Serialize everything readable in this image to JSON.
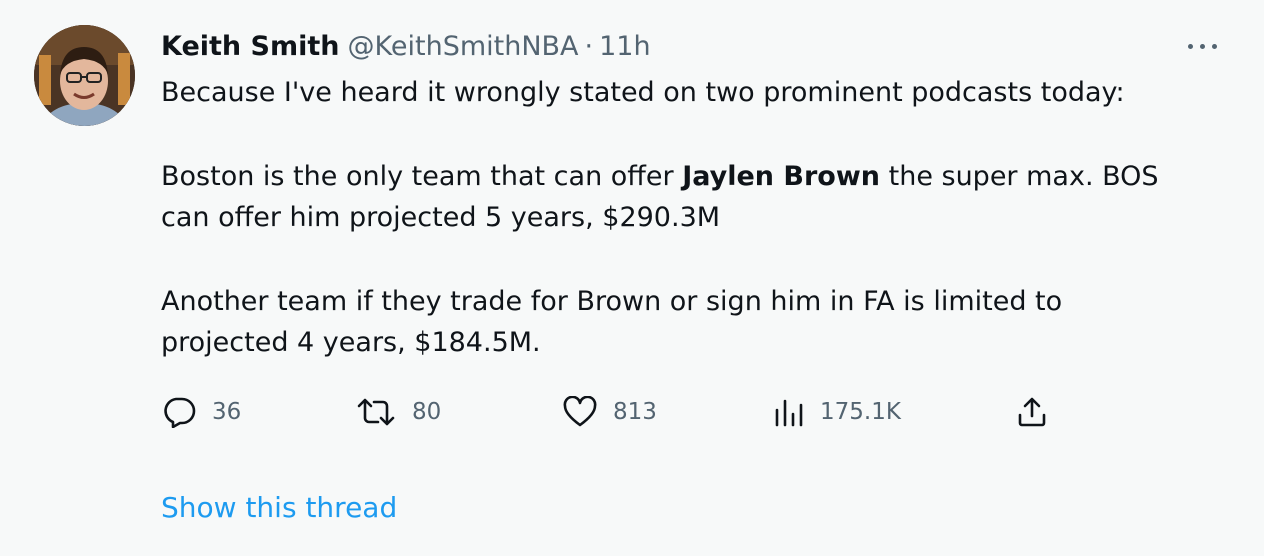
{
  "tweet": {
    "author_name": "Keith Smith",
    "handle": "@KeithSmithNBA",
    "separator": "·",
    "time": "11h",
    "body": {
      "line1": "Because I've heard it wrongly stated on two prominent podcasts today:",
      "para2_pre": "Boston is the only team that can offer ",
      "para2_bold": "Jaylen Brown",
      "para2_post": " the super max. BOS",
      "para2_line2": "can offer him projected 5 years, $290.3M",
      "para3_line1": "Another team if they trade for Brown or sign him in FA is limited to",
      "para3_line2": "projected 4 years, $184.5M."
    },
    "actions": {
      "reply_icon": "reply-icon",
      "reply_count": "36",
      "retweet_icon": "retweet-icon",
      "retweet_count": "80",
      "like_icon": "heart-icon",
      "like_count": "813",
      "views_icon": "analytics-icon",
      "views_count": "175.1K",
      "share_icon": "share-icon"
    },
    "show_thread": "Show this thread"
  },
  "colors": {
    "background": "#f7f9f9",
    "text_primary": "#0f1419",
    "text_secondary": "#536471",
    "link": "#1d9bf0"
  }
}
